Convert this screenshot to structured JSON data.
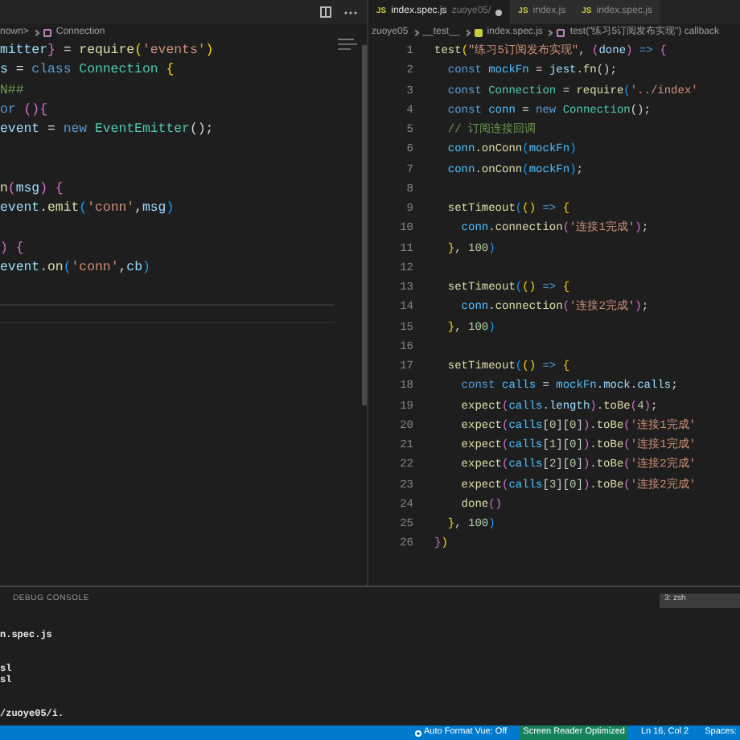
{
  "left_editor": {
    "breadcrumbs": [
      {
        "kind": "text",
        "text": "nown>"
      },
      {
        "kind": "symbol",
        "text": "Connection"
      }
    ],
    "lines": [
      {
        "tokens": [
          {
            "kind": "var",
            "text": "mitter"
          },
          {
            "kind": "bracket2",
            "text": "}"
          },
          {
            "kind": "plain",
            "text": " = "
          },
          {
            "kind": "func",
            "text": "require"
          },
          {
            "kind": "bracket1",
            "text": "("
          },
          {
            "kind": "string",
            "text": "'events'"
          },
          {
            "kind": "bracket1",
            "text": ")"
          }
        ]
      },
      {
        "tokens": [
          {
            "kind": "var",
            "text": "s"
          },
          {
            "kind": "plain",
            "text": " = "
          },
          {
            "kind": "keyword",
            "text": "class "
          },
          {
            "kind": "class",
            "text": "Connection "
          },
          {
            "kind": "bracket1",
            "text": "{"
          }
        ]
      },
      {
        "tokens": [
          {
            "kind": "comment",
            "text": "N##"
          }
        ]
      },
      {
        "tokens": [
          {
            "kind": "keyword",
            "text": "or "
          },
          {
            "kind": "bracket2",
            "text": "()"
          },
          {
            "kind": "bracket2",
            "text": "{"
          }
        ]
      },
      {
        "tokens": [
          {
            "kind": "var",
            "text": "event"
          },
          {
            "kind": "plain",
            "text": " = "
          },
          {
            "kind": "keyword",
            "text": "new "
          },
          {
            "kind": "class",
            "text": "EventEmitter"
          },
          {
            "kind": "plain",
            "text": "();"
          }
        ]
      },
      {
        "kind": "blank"
      },
      {
        "kind": "blank"
      },
      {
        "tokens": [
          {
            "kind": "func",
            "text": "n"
          },
          {
            "kind": "bracket2",
            "text": "("
          },
          {
            "kind": "var",
            "text": "msg"
          },
          {
            "kind": "bracket2",
            "text": ") {"
          }
        ]
      },
      {
        "tokens": [
          {
            "kind": "var",
            "text": "event"
          },
          {
            "kind": "plain",
            "text": "."
          },
          {
            "kind": "func",
            "text": "emit"
          },
          {
            "kind": "bracket3",
            "text": "("
          },
          {
            "kind": "string",
            "text": "'conn'"
          },
          {
            "kind": "plain",
            "text": ","
          },
          {
            "kind": "var",
            "text": "msg"
          },
          {
            "kind": "bracket3",
            "text": ")"
          }
        ]
      },
      {
        "kind": "blank"
      },
      {
        "tokens": [
          {
            "kind": "bracket2",
            "text": ") {"
          }
        ]
      },
      {
        "tokens": [
          {
            "kind": "var",
            "text": "event"
          },
          {
            "kind": "plain",
            "text": "."
          },
          {
            "kind": "func",
            "text": "on"
          },
          {
            "kind": "bracket3",
            "text": "("
          },
          {
            "kind": "string",
            "text": "'conn'"
          },
          {
            "kind": "plain",
            "text": ","
          },
          {
            "kind": "var",
            "text": "cb"
          },
          {
            "kind": "bracket3",
            "text": ")"
          }
        ]
      }
    ]
  },
  "right_editor": {
    "tabs": [
      {
        "icon_text": "JS",
        "label": "index.spec.js",
        "description": "zuoye05/",
        "modified": true,
        "selected": true
      },
      {
        "icon_text": "JS",
        "label": "index.js",
        "modified": false,
        "selected": false
      },
      {
        "icon_text": "JS",
        "label": "index.spec.js",
        "modified": false,
        "selected": false
      }
    ],
    "breadcrumbs": [
      {
        "kind": "text",
        "text": "zuoye05"
      },
      {
        "kind": "text",
        "text": "__test__"
      },
      {
        "kind": "file",
        "text": "index.spec.js"
      },
      {
        "kind": "symbol",
        "text": "test(\"练习5订阅发布实现\") callback"
      }
    ],
    "lines": [
      {
        "number": "1",
        "tokens": [
          {
            "kind": "func",
            "text": "test"
          },
          {
            "kind": "bracket1",
            "text": "("
          },
          {
            "kind": "string",
            "text": "\"练习5订阅发布实现\""
          },
          {
            "kind": "plain",
            "text": ", "
          },
          {
            "kind": "bracket2",
            "text": "("
          },
          {
            "kind": "var",
            "text": "done"
          },
          {
            "kind": "bracket2",
            "text": ")"
          },
          {
            "kind": "keyword",
            "text": " => "
          },
          {
            "kind": "bracket2",
            "text": "{"
          }
        ]
      },
      {
        "number": "2",
        "tokens": [
          {
            "kind": "keyword",
            "text": "  const "
          },
          {
            "kind": "const",
            "text": "mockFn"
          },
          {
            "kind": "plain",
            "text": " = "
          },
          {
            "kind": "var",
            "text": "jest"
          },
          {
            "kind": "plain",
            "text": "."
          },
          {
            "kind": "func",
            "text": "fn"
          },
          {
            "kind": "plain",
            "text": "();"
          }
        ]
      },
      {
        "number": "3",
        "tokens": [
          {
            "kind": "keyword",
            "text": "  const "
          },
          {
            "kind": "class",
            "text": "Connection"
          },
          {
            "kind": "plain",
            "text": " = "
          },
          {
            "kind": "func",
            "text": "require"
          },
          {
            "kind": "bracket3",
            "text": "("
          },
          {
            "kind": "string",
            "text": "'../index'"
          }
        ]
      },
      {
        "number": "4",
        "tokens": [
          {
            "kind": "keyword",
            "text": "  const "
          },
          {
            "kind": "const",
            "text": "conn"
          },
          {
            "kind": "plain",
            "text": " = "
          },
          {
            "kind": "keyword",
            "text": "new "
          },
          {
            "kind": "class",
            "text": "Connection"
          },
          {
            "kind": "plain",
            "text": "();"
          }
        ]
      },
      {
        "number": "5",
        "tokens": [
          {
            "kind": "comment",
            "text": "  // 订阅连接回调"
          }
        ]
      },
      {
        "number": "6",
        "tokens": [
          {
            "kind": "const",
            "text": "  conn"
          },
          {
            "kind": "plain",
            "text": "."
          },
          {
            "kind": "func",
            "text": "onConn"
          },
          {
            "kind": "bracket3",
            "text": "("
          },
          {
            "kind": "const",
            "text": "mockFn"
          },
          {
            "kind": "bracket3",
            "text": ")"
          }
        ]
      },
      {
        "number": "7",
        "tokens": [
          {
            "kind": "const",
            "text": "  conn"
          },
          {
            "kind": "plain",
            "text": "."
          },
          {
            "kind": "func",
            "text": "onConn"
          },
          {
            "kind": "bracket3",
            "text": "("
          },
          {
            "kind": "const",
            "text": "mockFn"
          },
          {
            "kind": "bracket3",
            "text": ")"
          },
          {
            "kind": "plain",
            "text": ";"
          }
        ]
      },
      {
        "number": "8"
      },
      {
        "number": "9",
        "tokens": [
          {
            "kind": "func",
            "text": "  setTimeout"
          },
          {
            "kind": "bracket3",
            "text": "("
          },
          {
            "kind": "bracket1",
            "text": "()"
          },
          {
            "kind": "keyword",
            "text": " => "
          },
          {
            "kind": "bracket1",
            "text": "{"
          }
        ]
      },
      {
        "number": "10",
        "tokens": [
          {
            "kind": "const",
            "text": "    conn"
          },
          {
            "kind": "plain",
            "text": "."
          },
          {
            "kind": "func",
            "text": "connection"
          },
          {
            "kind": "bracket2",
            "text": "("
          },
          {
            "kind": "string",
            "text": "'连接1完成'"
          },
          {
            "kind": "bracket2",
            "text": ")"
          },
          {
            "kind": "plain",
            "text": ";"
          }
        ]
      },
      {
        "number": "11",
        "tokens": [
          {
            "kind": "bracket1",
            "text": "  }"
          },
          {
            "kind": "plain",
            "text": ", "
          },
          {
            "kind": "number",
            "text": "100"
          },
          {
            "kind": "bracket3",
            "text": ")"
          }
        ]
      },
      {
        "number": "12"
      },
      {
        "number": "13",
        "tokens": [
          {
            "kind": "func",
            "text": "  setTimeout"
          },
          {
            "kind": "bracket3",
            "text": "("
          },
          {
            "kind": "bracket1",
            "text": "()"
          },
          {
            "kind": "keyword",
            "text": " => "
          },
          {
            "kind": "bracket1",
            "text": "{"
          }
        ]
      },
      {
        "number": "14",
        "tokens": [
          {
            "kind": "const",
            "text": "    conn"
          },
          {
            "kind": "plain",
            "text": "."
          },
          {
            "kind": "func",
            "text": "connection"
          },
          {
            "kind": "bracket2",
            "text": "("
          },
          {
            "kind": "string",
            "text": "'连接2完成'"
          },
          {
            "kind": "bracket2",
            "text": ")"
          },
          {
            "kind": "plain",
            "text": ";"
          }
        ]
      },
      {
        "number": "15",
        "tokens": [
          {
            "kind": "bracket1",
            "text": "  }"
          },
          {
            "kind": "plain",
            "text": ", "
          },
          {
            "kind": "number",
            "text": "100"
          },
          {
            "kind": "bracket3",
            "text": ")"
          }
        ]
      },
      {
        "number": "16"
      },
      {
        "number": "17",
        "tokens": [
          {
            "kind": "func",
            "text": "  setTimeout"
          },
          {
            "kind": "bracket3",
            "text": "("
          },
          {
            "kind": "bracket1",
            "text": "()"
          },
          {
            "kind": "keyword",
            "text": " => "
          },
          {
            "kind": "bracket1",
            "text": "{"
          }
        ]
      },
      {
        "number": "18",
        "tokens": [
          {
            "kind": "keyword",
            "text": "    const "
          },
          {
            "kind": "const",
            "text": "calls"
          },
          {
            "kind": "plain",
            "text": " = "
          },
          {
            "kind": "const",
            "text": "mockFn"
          },
          {
            "kind": "plain",
            "text": "."
          },
          {
            "kind": "var",
            "text": "mock"
          },
          {
            "kind": "plain",
            "text": "."
          },
          {
            "kind": "var",
            "text": "calls"
          },
          {
            "kind": "plain",
            "text": ";"
          }
        ]
      },
      {
        "number": "19",
        "tokens": [
          {
            "kind": "func",
            "text": "    expect"
          },
          {
            "kind": "bracket2",
            "text": "("
          },
          {
            "kind": "const",
            "text": "calls"
          },
          {
            "kind": "plain",
            "text": "."
          },
          {
            "kind": "var",
            "text": "length"
          },
          {
            "kind": "bracket2",
            "text": ")"
          },
          {
            "kind": "plain",
            "text": "."
          },
          {
            "kind": "func",
            "text": "toBe"
          },
          {
            "kind": "bracket2",
            "text": "("
          },
          {
            "kind": "number",
            "text": "4"
          },
          {
            "kind": "bracket2",
            "text": ")"
          },
          {
            "kind": "plain",
            "text": ";"
          }
        ]
      },
      {
        "number": "20",
        "tokens": [
          {
            "kind": "func",
            "text": "    expect"
          },
          {
            "kind": "bracket2",
            "text": "("
          },
          {
            "kind": "const",
            "text": "calls"
          },
          {
            "kind": "plain",
            "text": "["
          },
          {
            "kind": "number",
            "text": "0"
          },
          {
            "kind": "plain",
            "text": "]["
          },
          {
            "kind": "number",
            "text": "0"
          },
          {
            "kind": "plain",
            "text": "]"
          },
          {
            "kind": "bracket2",
            "text": ")"
          },
          {
            "kind": "plain",
            "text": "."
          },
          {
            "kind": "func",
            "text": "toBe"
          },
          {
            "kind": "bracket2",
            "text": "("
          },
          {
            "kind": "string",
            "text": "'连接1完成'"
          }
        ]
      },
      {
        "number": "21",
        "tokens": [
          {
            "kind": "func",
            "text": "    expect"
          },
          {
            "kind": "bracket2",
            "text": "("
          },
          {
            "kind": "const",
            "text": "calls"
          },
          {
            "kind": "plain",
            "text": "["
          },
          {
            "kind": "number",
            "text": "1"
          },
          {
            "kind": "plain",
            "text": "]["
          },
          {
            "kind": "number",
            "text": "0"
          },
          {
            "kind": "plain",
            "text": "]"
          },
          {
            "kind": "bracket2",
            "text": ")"
          },
          {
            "kind": "plain",
            "text": "."
          },
          {
            "kind": "func",
            "text": "toBe"
          },
          {
            "kind": "bracket2",
            "text": "("
          },
          {
            "kind": "string",
            "text": "'连接1完成'"
          }
        ]
      },
      {
        "number": "22",
        "tokens": [
          {
            "kind": "func",
            "text": "    expect"
          },
          {
            "kind": "bracket2",
            "text": "("
          },
          {
            "kind": "const",
            "text": "calls"
          },
          {
            "kind": "plain",
            "text": "["
          },
          {
            "kind": "number",
            "text": "2"
          },
          {
            "kind": "plain",
            "text": "]["
          },
          {
            "kind": "number",
            "text": "0"
          },
          {
            "kind": "plain",
            "text": "]"
          },
          {
            "kind": "bracket2",
            "text": ")"
          },
          {
            "kind": "plain",
            "text": "."
          },
          {
            "kind": "func",
            "text": "toBe"
          },
          {
            "kind": "bracket2",
            "text": "("
          },
          {
            "kind": "string",
            "text": "'连接2完成'"
          }
        ]
      },
      {
        "number": "23",
        "tokens": [
          {
            "kind": "func",
            "text": "    expect"
          },
          {
            "kind": "bracket2",
            "text": "("
          },
          {
            "kind": "const",
            "text": "calls"
          },
          {
            "kind": "plain",
            "text": "["
          },
          {
            "kind": "number",
            "text": "3"
          },
          {
            "kind": "plain",
            "text": "]["
          },
          {
            "kind": "number",
            "text": "0"
          },
          {
            "kind": "plain",
            "text": "]"
          },
          {
            "kind": "bracket2",
            "text": ")"
          },
          {
            "kind": "plain",
            "text": "."
          },
          {
            "kind": "func",
            "text": "toBe"
          },
          {
            "kind": "bracket2",
            "text": "("
          },
          {
            "kind": "string",
            "text": "'连接2完成'"
          }
        ]
      },
      {
        "number": "24",
        "tokens": [
          {
            "kind": "func",
            "text": "    done"
          },
          {
            "kind": "bracket2",
            "text": "()"
          }
        ]
      },
      {
        "number": "25",
        "tokens": [
          {
            "kind": "bracket1",
            "text": "  }"
          },
          {
            "kind": "plain",
            "text": ", "
          },
          {
            "kind": "number",
            "text": "100"
          },
          {
            "kind": "bracket3",
            "text": ")"
          }
        ]
      },
      {
        "number": "26",
        "tokens": [
          {
            "kind": "bracket2",
            "text": "}"
          },
          {
            "kind": "bracket1",
            "text": ")"
          }
        ]
      }
    ]
  },
  "panel": {
    "tab": "DEBUG CONSOLE",
    "terminal_select": "3: zsh",
    "lines": [
      {
        "kind": "output",
        "text": "n.spec.js"
      },
      {
        "kind": "blank"
      },
      {
        "kind": "blank"
      },
      {
        "kind": "output",
        "text": "sl"
      },
      {
        "kind": "output",
        "text": "sl"
      },
      {
        "kind": "blank"
      },
      {
        "kind": "blank"
      },
      {
        "kind": "output",
        "text": "/zuoye05/i."
      }
    ]
  },
  "status_bar": {
    "items": [
      {
        "kind": "icon",
        "text": "Auto Format Vue: Off"
      },
      {
        "kind": "highlight",
        "text": "Screen Reader Optimized"
      },
      {
        "kind": "text",
        "text": "Ln 16, Col 2"
      },
      {
        "kind": "text",
        "text": "Spaces:"
      }
    ]
  }
}
